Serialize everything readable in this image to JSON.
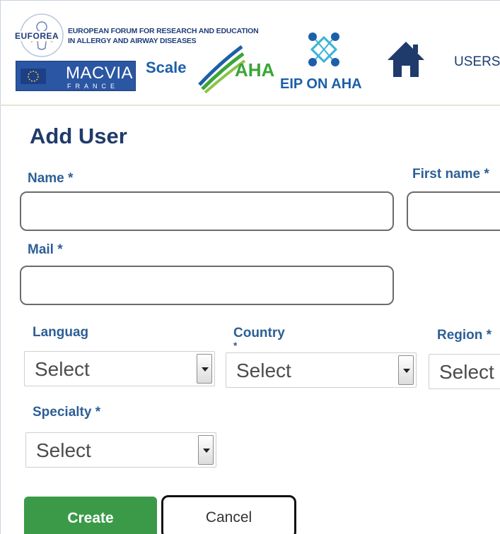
{
  "header": {
    "euforea_line1": "EUROPEAN FORUM FOR RESEARCH AND EDUCATION",
    "euforea_line2": "IN ALLERGY AND AIRWAY DISEASES",
    "euforea_wordmark": "EUFOREA",
    "macvia_title": "MACVIA",
    "macvia_sub": "FRANCE",
    "scale_label": "Scale",
    "aha_label": "AHA",
    "eip_label": "EIP ON AHA",
    "users_link": "USERS",
    "icons": {
      "home": "home-icon",
      "eip": "network-icon"
    }
  },
  "form": {
    "title": "Add User",
    "name_label": "Name *",
    "name_value": "",
    "first_name_label": "First name *",
    "first_name_value": "",
    "mail_label": "Mail *",
    "mail_value": "",
    "language_label": "Languag",
    "language_value": "Select",
    "country_label": "Country",
    "country_extra": "*",
    "country_value": "Select",
    "region_label": "Region *",
    "region_value": "Select",
    "specialty_label": "Specialty *",
    "specialty_value": "Select",
    "create_label": "Create",
    "cancel_label": "Cancel"
  },
  "colors": {
    "label": "#2d5f96",
    "title": "#1f3b6b",
    "create_button": "#3b9a47"
  }
}
